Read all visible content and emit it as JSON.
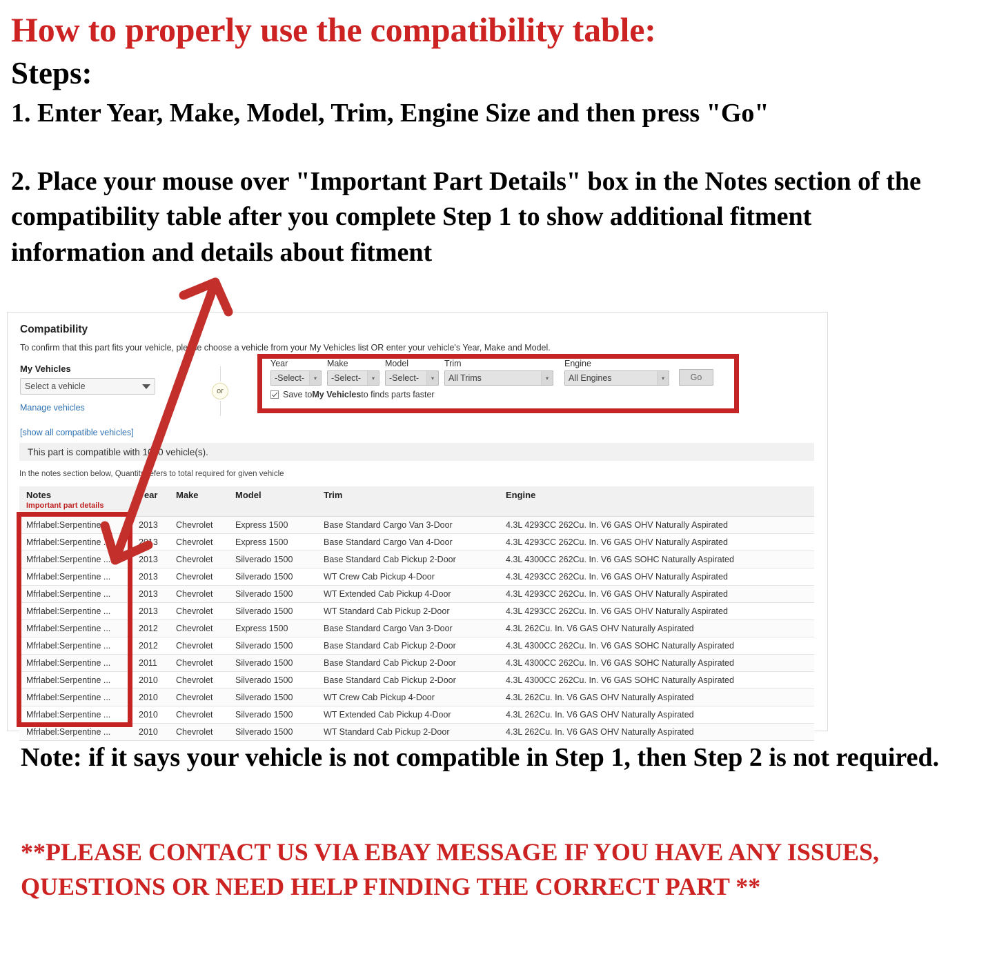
{
  "headline": "How to properly use the compatibility table:",
  "steps_label": "Steps:",
  "step1": "1. Enter Year, Make, Model, Trim, Engine Size and then press \"Go\"",
  "step2": "2. Place your mouse over \"Important Part Details\" box in the Notes section of the compatibility table after you complete Step 1 to show additional fitment information and details about fitment",
  "note": "Note: if it says your vehicle is not compatible in Step 1, then Step 2 is not required.",
  "contact": "**PLEASE CONTACT US VIA EBAY MESSAGE IF YOU HAVE ANY ISSUES, QUESTIONS OR NEED HELP FINDING THE CORRECT PART **",
  "colors": {
    "headline_red": "#cc2222",
    "highlight_red": "#c42424",
    "link_blue": "#3072b3",
    "notes_sub_red": "#c02020"
  },
  "panel": {
    "title": "Compatibility",
    "subtitle": "To confirm that this part fits your vehicle, please choose a vehicle from your My Vehicles list OR enter your vehicle's Year, Make and Model.",
    "my_vehicles": {
      "label": "My Vehicles",
      "select_value": "Select a vehicle",
      "manage_link": "Manage vehicles",
      "show_all_link": "[show all compatible vehicles]"
    },
    "or_label": "or",
    "form": {
      "year": {
        "label": "Year",
        "value": "-Select-"
      },
      "make": {
        "label": "Make",
        "value": "-Select-"
      },
      "model": {
        "label": "Model",
        "value": "-Select-"
      },
      "trim": {
        "label": "Trim",
        "value": "All Trims"
      },
      "engine": {
        "label": "Engine",
        "value": "All Engines"
      },
      "go_label": "Go",
      "save_prefix": "Save to ",
      "save_bold": "My Vehicles",
      "save_suffix": " to finds parts faster"
    },
    "count_text": "This part is compatible with 1000 vehicle(s).",
    "qty_note": "In the notes section below, Quantity refers to total required for given vehicle",
    "table": {
      "headers": {
        "notes": "Notes",
        "notes_sub": "Important part details",
        "year": "Year",
        "make": "Make",
        "model": "Model",
        "trim": "Trim",
        "engine": "Engine"
      },
      "rows": [
        {
          "notes": "Mfrlabel:Serpentine ...",
          "year": "2013",
          "make": "Chevrolet",
          "model": "Express 1500",
          "trim": "Base Standard Cargo Van 3-Door",
          "engine": "4.3L 4293CC 262Cu. In. V6 GAS OHV Naturally Aspirated"
        },
        {
          "notes": "Mfrlabel:Serpentine ...",
          "year": "2013",
          "make": "Chevrolet",
          "model": "Express 1500",
          "trim": "Base Standard Cargo Van 4-Door",
          "engine": "4.3L 4293CC 262Cu. In. V6 GAS OHV Naturally Aspirated"
        },
        {
          "notes": "Mfrlabel:Serpentine ...",
          "year": "2013",
          "make": "Chevrolet",
          "model": "Silverado 1500",
          "trim": "Base Standard Cab Pickup 2-Door",
          "engine": "4.3L 4300CC 262Cu. In. V6 GAS SOHC Naturally Aspirated"
        },
        {
          "notes": "Mfrlabel:Serpentine ...",
          "year": "2013",
          "make": "Chevrolet",
          "model": "Silverado 1500",
          "trim": "WT Crew Cab Pickup 4-Door",
          "engine": "4.3L 4293CC 262Cu. In. V6 GAS OHV Naturally Aspirated"
        },
        {
          "notes": "Mfrlabel:Serpentine ...",
          "year": "2013",
          "make": "Chevrolet",
          "model": "Silverado 1500",
          "trim": "WT Extended Cab Pickup 4-Door",
          "engine": "4.3L 4293CC 262Cu. In. V6 GAS OHV Naturally Aspirated"
        },
        {
          "notes": "Mfrlabel:Serpentine ...",
          "year": "2013",
          "make": "Chevrolet",
          "model": "Silverado 1500",
          "trim": "WT Standard Cab Pickup 2-Door",
          "engine": "4.3L 4293CC 262Cu. In. V6 GAS OHV Naturally Aspirated"
        },
        {
          "notes": "Mfrlabel:Serpentine ...",
          "year": "2012",
          "make": "Chevrolet",
          "model": "Express 1500",
          "trim": "Base Standard Cargo Van 3-Door",
          "engine": "4.3L 262Cu. In. V6 GAS OHV Naturally Aspirated"
        },
        {
          "notes": "Mfrlabel:Serpentine ...",
          "year": "2012",
          "make": "Chevrolet",
          "model": "Silverado 1500",
          "trim": "Base Standard Cab Pickup 2-Door",
          "engine": "4.3L 4300CC 262Cu. In. V6 GAS SOHC Naturally Aspirated"
        },
        {
          "notes": "Mfrlabel:Serpentine ...",
          "year": "2011",
          "make": "Chevrolet",
          "model": "Silverado 1500",
          "trim": "Base Standard Cab Pickup 2-Door",
          "engine": "4.3L 4300CC 262Cu. In. V6 GAS SOHC Naturally Aspirated"
        },
        {
          "notes": "Mfrlabel:Serpentine ...",
          "year": "2010",
          "make": "Chevrolet",
          "model": "Silverado 1500",
          "trim": "Base Standard Cab Pickup 2-Door",
          "engine": "4.3L 4300CC 262Cu. In. V6 GAS SOHC Naturally Aspirated"
        },
        {
          "notes": "Mfrlabel:Serpentine ...",
          "year": "2010",
          "make": "Chevrolet",
          "model": "Silverado 1500",
          "trim": "WT Crew Cab Pickup 4-Door",
          "engine": "4.3L 262Cu. In. V6 GAS OHV Naturally Aspirated"
        },
        {
          "notes": "Mfrlabel:Serpentine ...",
          "year": "2010",
          "make": "Chevrolet",
          "model": "Silverado 1500",
          "trim": "WT Extended Cab Pickup 4-Door",
          "engine": "4.3L 262Cu. In. V6 GAS OHV Naturally Aspirated"
        },
        {
          "notes": "Mfrlabel:Serpentine ...",
          "year": "2010",
          "make": "Chevrolet",
          "model": "Silverado 1500",
          "trim": "WT Standard Cab Pickup 2-Door",
          "engine": "4.3L 262Cu. In. V6 GAS OHV Naturally Aspirated"
        }
      ]
    }
  }
}
